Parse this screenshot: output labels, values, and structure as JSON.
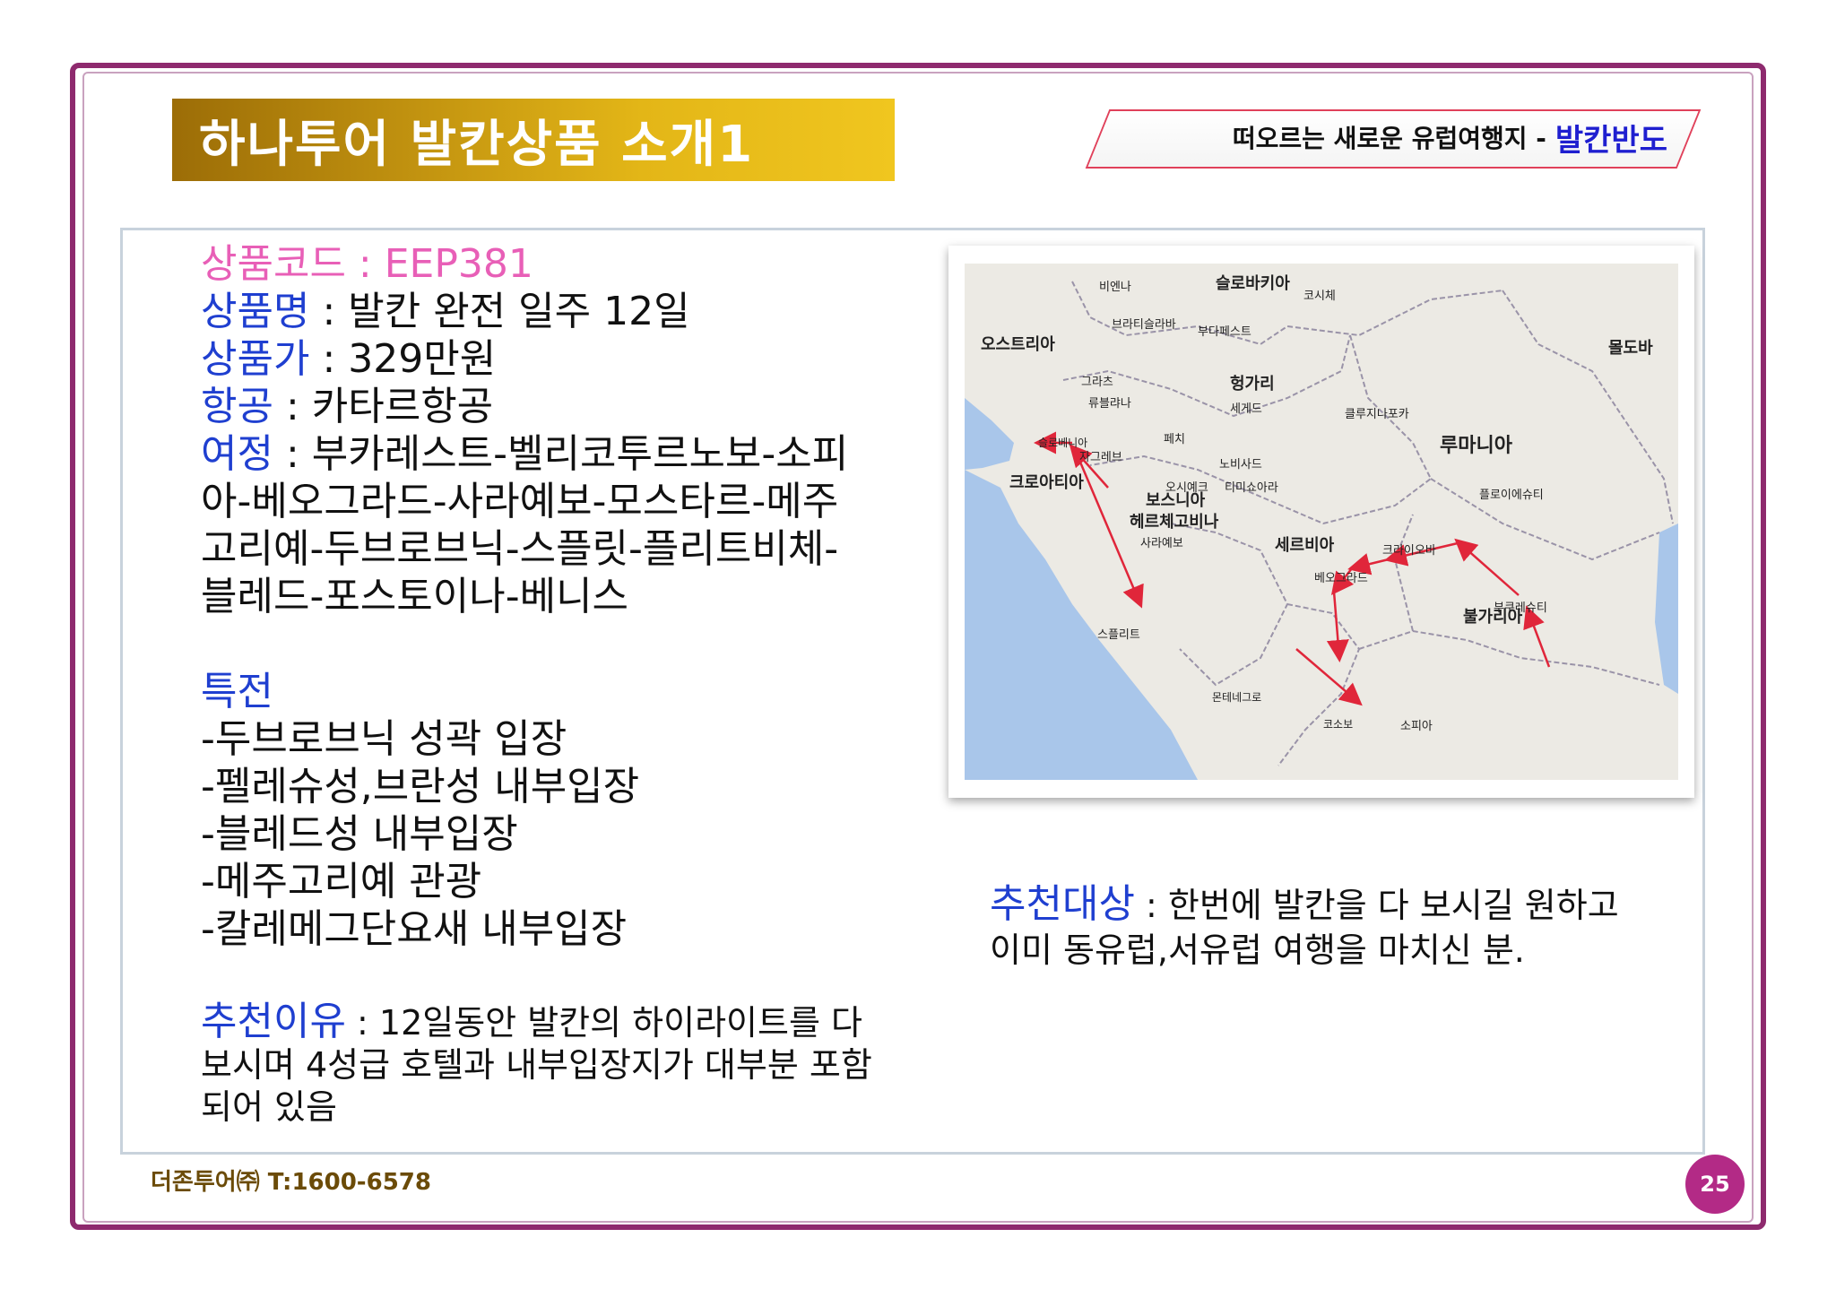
{
  "header": {
    "title": "하나투어 발칸상품 소개1",
    "tagline_prefix": "떠오르는 새로운 유럽여행지 -",
    "tagline_highlight": "발칸반도"
  },
  "product": {
    "code_label": "상품코드",
    "code_value": "EEP381",
    "name_label": "상품명",
    "name_value": "발칸 완전 일주 12일",
    "price_label": "상품가",
    "price_value": "329만원",
    "airline_label": "항공",
    "airline_value": "카타르항공",
    "itinerary_label": "여정",
    "itinerary_lines": [
      "부카레스트-벨리코투르노보-소피",
      "아-베오그라드-사라예보-모스타르-메주",
      "고리예-두브로브닉-스플릿-플리트비체-",
      "블레드-포스토이나-베니스"
    ],
    "benefits_label": "특전",
    "benefits": [
      "-두브로브닉 성곽 입장",
      "-펠레슈성,브란성 내부입장",
      "-블레드성 내부입장",
      "-메주고리예 관광",
      "-칼레메그단요새 내부입장"
    ],
    "reason_label": "추천이유",
    "reason_lines": [
      "12일동안 발칸의 하이라이트를 다",
      "보시며 4성급 호텔과 내부입장지가 대부분 포함",
      "되어 있음"
    ]
  },
  "recommend": {
    "label": "추천대상",
    "lines": [
      "한번에 발칸을 다 보시길 원하고",
      "이미 동유럽,서유럽 여행을 마치신 분."
    ]
  },
  "map": {
    "countries": [
      "슬로바키아",
      "오스트리아",
      "헝가리",
      "루마니아",
      "크로아티아",
      "보스니아",
      "헤르체고비나",
      "세르비아",
      "불가리아",
      "몰도바",
      "슬로베니아",
      "몬테네그로",
      "코소보"
    ],
    "cities": [
      "비엔나",
      "브라티슬라바",
      "부다페스트",
      "자그레브",
      "류블랴나",
      "사라예보",
      "베오그라드",
      "소피아",
      "부쿠레슈티",
      "스플리트",
      "클루지나포카",
      "티미쇼아라",
      "크라이오바",
      "플로이에슈티",
      "세게드",
      "오시예크",
      "노비사드",
      "코시체",
      "페치",
      "그라츠"
    ]
  },
  "footer": {
    "company": "더존투어㈜ T:1600-6578",
    "page_number": "25"
  },
  "colors": {
    "frame": "#8e2a6e",
    "banner_gold": "#e3b617",
    "label_blue": "#1f3fd0",
    "label_pink": "#e85fb7",
    "page_badge": "#b32a86",
    "route_red": "#e0263a"
  }
}
